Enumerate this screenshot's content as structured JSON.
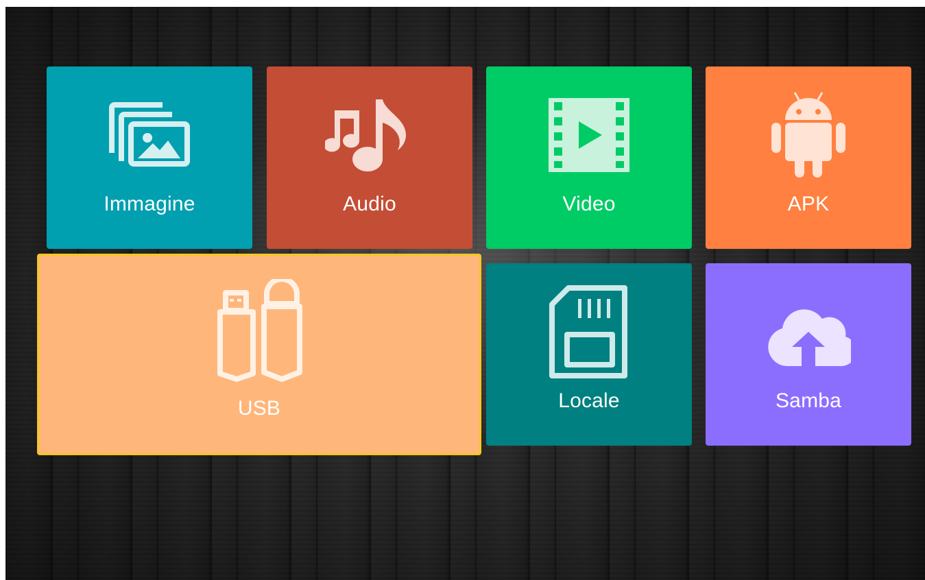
{
  "tiles": [
    {
      "id": "immagine",
      "label": "Immagine",
      "color": "#00a0b0",
      "icon": "image-gallery-icon"
    },
    {
      "id": "audio",
      "label": "Audio",
      "color": "#c44d35",
      "icon": "music-note-icon"
    },
    {
      "id": "video",
      "label": "Video",
      "color": "#00cc66",
      "icon": "film-play-icon"
    },
    {
      "id": "apk",
      "label": "APK",
      "color": "#ff8040",
      "icon": "android-icon"
    },
    {
      "id": "usb",
      "label": "USB",
      "color": "#ffb67b",
      "icon": "usb-drive-icon",
      "focused": true,
      "focus_color": "#f6c623"
    },
    {
      "id": "locale",
      "label": "Locale",
      "color": "#008080",
      "icon": "sd-card-icon"
    },
    {
      "id": "samba",
      "label": "Samba",
      "color": "#8c6eff",
      "icon": "cloud-upload-icon"
    }
  ]
}
